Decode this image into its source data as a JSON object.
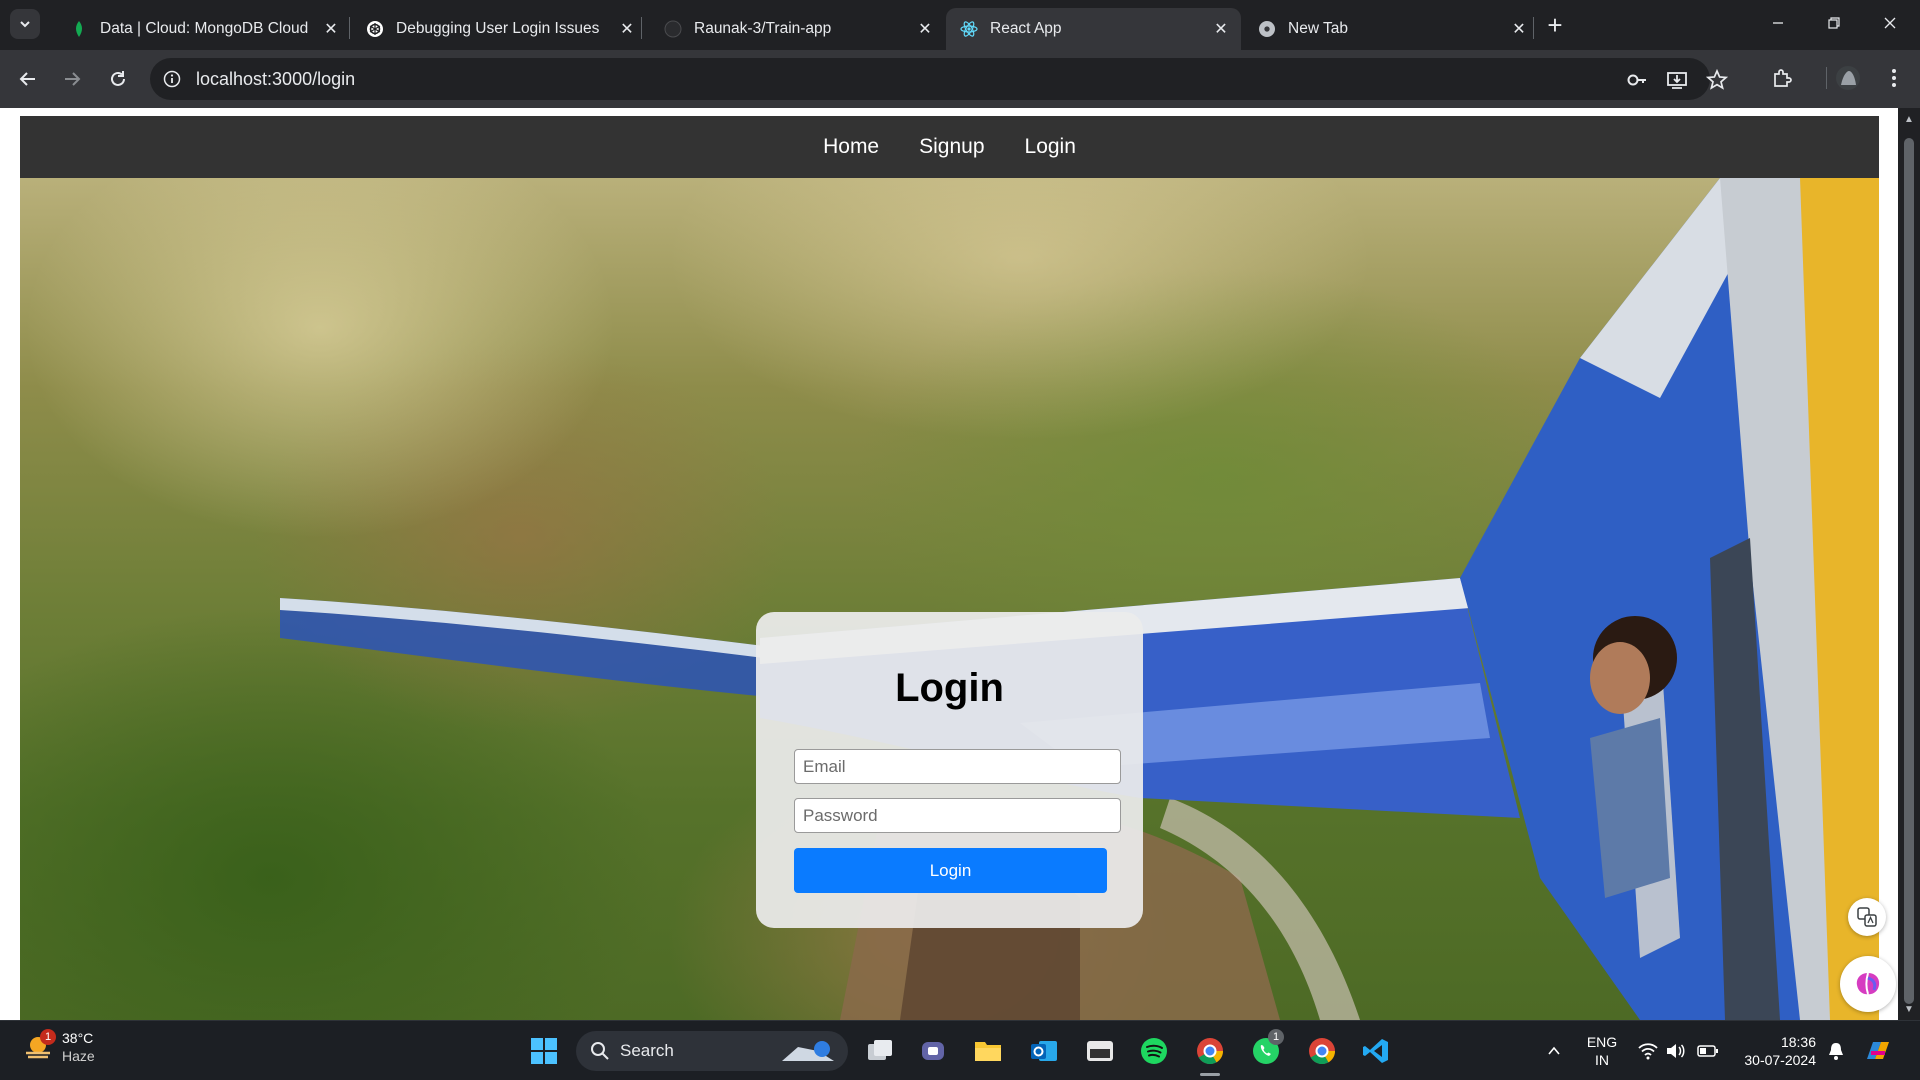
{
  "browser": {
    "tabs": [
      {
        "title": "Data | Cloud: MongoDB Cloud",
        "favicon": "mongodb-leaf-icon"
      },
      {
        "title": "Debugging User Login Issues",
        "favicon": "chatgpt-icon"
      },
      {
        "title": "Raunak-3/Train-app",
        "favicon": "github-icon"
      },
      {
        "title": "React App",
        "favicon": "react-icon",
        "active": true
      },
      {
        "title": "New Tab",
        "favicon": "chrome-icon"
      }
    ],
    "url": "localhost:3000/login"
  },
  "app": {
    "nav": {
      "home": "Home",
      "signup": "Signup",
      "login": "Login"
    },
    "login_form": {
      "title": "Login",
      "email_placeholder": "Email",
      "password_placeholder": "Password",
      "submit_label": "Login",
      "button_color": "#0a7bff"
    }
  },
  "taskbar": {
    "weather": {
      "temp": "38°C",
      "condition": "Haze",
      "badge": "1"
    },
    "search_label": "Search",
    "language": {
      "lang": "ENG",
      "region": "IN"
    },
    "time": "18:36",
    "date": "30-07-2024",
    "whatsapp_badge": "1",
    "apps": [
      "windows-start-icon",
      "task-view-icon",
      "teams-icon",
      "file-explorer-icon",
      "outlook-icon",
      "app-icon",
      "spotify-icon",
      "chrome-icon",
      "whatsapp-icon",
      "chrome-profile-icon",
      "vscode-icon"
    ]
  }
}
